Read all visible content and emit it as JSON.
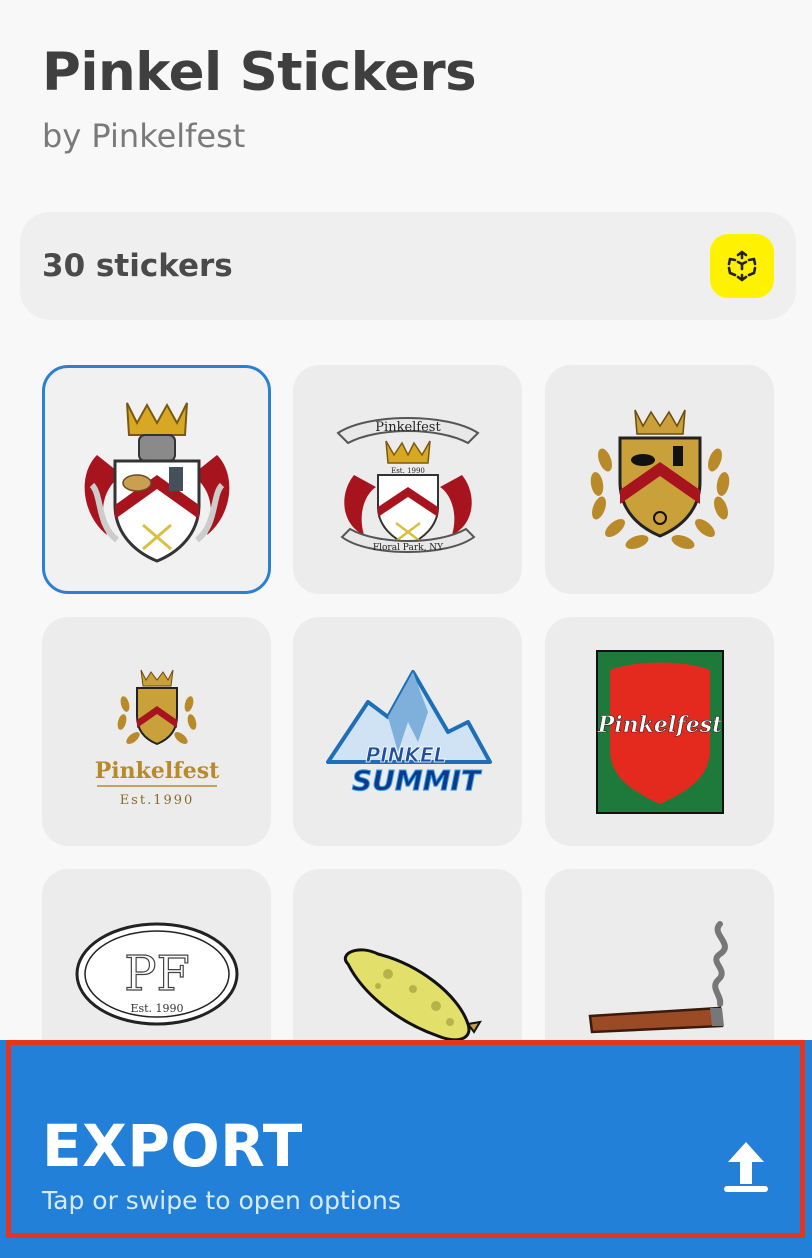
{
  "header": {
    "title": "Pinkel Stickers",
    "author": "by Pinkelfest"
  },
  "pack": {
    "count_label": "30 stickers",
    "ar_icon": "ar-cube-icon"
  },
  "stickers": [
    {
      "name": "crest-full-color",
      "selected": true
    },
    {
      "name": "crest-banner-floral-park",
      "text_top": "Pinkelfest",
      "text_mid": "Est. 1990",
      "text_bottom": "Floral Park, NY"
    },
    {
      "name": "crest-laurel-gold"
    },
    {
      "name": "crest-pinkelfest-est",
      "text_main": "Pinkelfest",
      "text_sub": "Est.1990"
    },
    {
      "name": "pinkel-summit",
      "text_top": "PINKEL",
      "text_bottom": "SUMMIT"
    },
    {
      "name": "pinkelfest-shield-green",
      "text_main": "Pinkelfest"
    },
    {
      "name": "pf-oval-logo",
      "text_main": "PF",
      "text_sub": "Est. 1990"
    },
    {
      "name": "pickle"
    },
    {
      "name": "cigar"
    }
  ],
  "export": {
    "title": "EXPORT",
    "subtitle": "Tap or swipe to open options",
    "icon": "upload-arrow-icon"
  },
  "colors": {
    "accent": "#2380d9",
    "highlight": "#e8341f",
    "ar_yellow": "#fff200"
  }
}
